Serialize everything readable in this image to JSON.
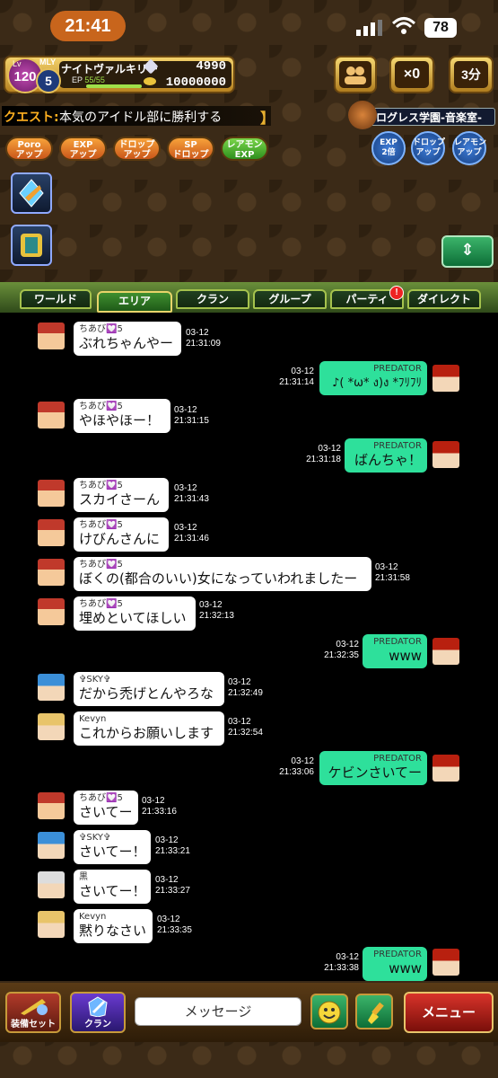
{
  "status": {
    "time": "21:41",
    "battery": "78"
  },
  "player": {
    "lv_label": "Lv",
    "level": "120",
    "mly_label": "MLY",
    "mly": "5",
    "name": "ナイトヴァルキリー",
    "ep_label": "EP",
    "ep": "55/55",
    "gems": "4990",
    "gold": "10000000"
  },
  "top_buttons": {
    "ticket": "×0",
    "timer": "3分"
  },
  "quest": {
    "label": "クエスト:",
    "text": "本気のアイドル部に勝利する",
    "location": "ログレス学園-音楽室-"
  },
  "buffs": [
    {
      "label": "Poro\nアップ"
    },
    {
      "label": "EXP\nアップ"
    },
    {
      "label": "ドロップ\nアップ"
    },
    {
      "label": "SP\nドロップ"
    },
    {
      "label": "レアモン\nEXP"
    }
  ],
  "round_buffs": [
    {
      "label": "EXP\n2倍"
    },
    {
      "label": "ドロップ\nアップ"
    },
    {
      "label": "レアモン\nアップ"
    }
  ],
  "tabs": [
    {
      "label": "ワールド"
    },
    {
      "label": "エリア"
    },
    {
      "label": "クラン"
    },
    {
      "label": "グループ"
    },
    {
      "label": "パーティ"
    },
    {
      "label": "ダイレクト"
    }
  ],
  "notification": "!",
  "messages": [
    {
      "side": "left",
      "name": "ちあび💟5",
      "text": "ぶれちゃんやー",
      "date": "03-12",
      "time": "21:31:09"
    },
    {
      "side": "right",
      "name": "PREDATOR",
      "text": "♪( *ω* ง)ง *ﾌﾘﾌﾘ",
      "date": "03-12",
      "time": "21:31:14"
    },
    {
      "side": "left",
      "name": "ちあび💟5",
      "text": "やほやほー！",
      "date": "03-12",
      "time": "21:31:15"
    },
    {
      "side": "right",
      "name": "PREDATOR",
      "text": "ばんちゃ！",
      "date": "03-12",
      "time": "21:31:18"
    },
    {
      "side": "left",
      "name": "ちあび💟5",
      "text": "スカイさーん",
      "date": "03-12",
      "time": "21:31:43"
    },
    {
      "side": "left",
      "name": "ちあび💟5",
      "text": "けびんさんに",
      "date": "03-12",
      "time": "21:31:46"
    },
    {
      "side": "left",
      "name": "ちあび💟5",
      "text": "ぼくの(都合のいい)女になっていわれましたー",
      "date": "03-12",
      "time": "21:31:58"
    },
    {
      "side": "left",
      "name": "ちあび💟5",
      "text": "埋めといてほしい",
      "date": "03-12",
      "time": "21:32:13"
    },
    {
      "side": "right",
      "name": "PREDATOR",
      "text": "www",
      "date": "03-12",
      "time": "21:32:35"
    },
    {
      "side": "left",
      "name": "✞SKY✞",
      "text": "だから禿げとんやろな",
      "date": "03-12",
      "time": "21:32:49"
    },
    {
      "side": "left",
      "name": "Kevyn",
      "text": "これからお願いします",
      "date": "03-12",
      "time": "21:32:54"
    },
    {
      "side": "right",
      "name": "PREDATOR",
      "text": "ケビンさいてー",
      "date": "03-12",
      "time": "21:33:06"
    },
    {
      "side": "left",
      "name": "ちあび💟5",
      "text": "さいてー",
      "date": "03-12",
      "time": "21:33:16"
    },
    {
      "side": "left",
      "name": "✞SKY✞",
      "text": "さいてー！",
      "date": "03-12",
      "time": "21:33:21"
    },
    {
      "side": "left",
      "name": "黒",
      "text": "さいてー！",
      "date": "03-12",
      "time": "21:33:27"
    },
    {
      "side": "left",
      "name": "Kevyn",
      "text": "黙りなさい",
      "date": "03-12",
      "time": "21:33:35"
    },
    {
      "side": "right",
      "name": "PREDATOR",
      "text": "www",
      "date": "03-12",
      "time": "21:33:38"
    }
  ],
  "bottom": {
    "equip": "装備セット",
    "clan": "クラン",
    "placeholder": "メッセージ",
    "menu": "メニュー"
  }
}
